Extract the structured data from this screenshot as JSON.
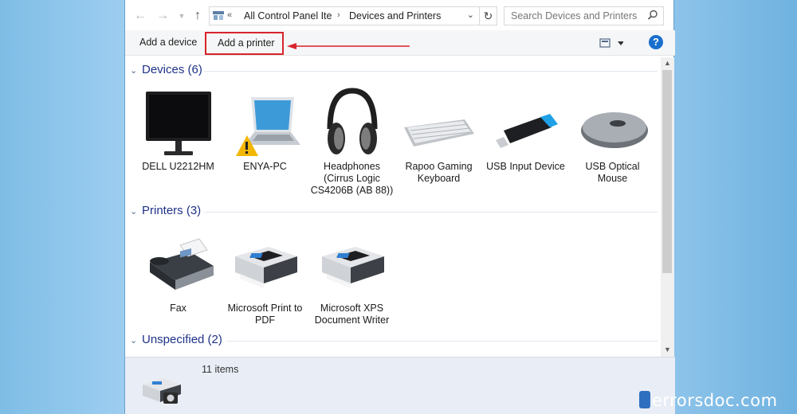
{
  "address_bar": {
    "back_icon": "arrow-left-icon",
    "forward_icon": "arrow-right-icon",
    "history_icon": "chevron-down-icon",
    "up_icon": "arrow-up-icon",
    "overflow": "«",
    "crumbs": [
      "All Control Panel Ite",
      "Devices and Printers"
    ],
    "search_placeholder": "Search Devices and Printers"
  },
  "toolbar": {
    "add_device": "Add a device",
    "add_printer": "Add a printer",
    "help": "?"
  },
  "groups": {
    "devices": {
      "title": "Devices (6)",
      "items": [
        {
          "label": "DELL U2212HM",
          "icon": "monitor-icon"
        },
        {
          "label": "ENYA-PC",
          "icon": "laptop-icon"
        },
        {
          "label": "Headphones (Cirrus Logic CS4206B (AB 88))",
          "icon": "headphones-icon"
        },
        {
          "label": "Rapoo Gaming Keyboard",
          "icon": "keyboard-icon"
        },
        {
          "label": "USB Input Device",
          "icon": "usb-dongle-icon"
        },
        {
          "label": "USB Optical Mouse",
          "icon": "mouse-icon"
        }
      ]
    },
    "printers": {
      "title": "Printers (3)",
      "items": [
        {
          "label": "Fax",
          "icon": "fax-icon"
        },
        {
          "label": "Microsoft Print to PDF",
          "icon": "printer-icon"
        },
        {
          "label": "Microsoft XPS Document Writer",
          "icon": "printer-icon"
        }
      ]
    },
    "unspecified": {
      "title": "Unspecified (2)"
    }
  },
  "status": {
    "item_count": "11 items"
  },
  "watermark": "errorsdoc.com",
  "colors": {
    "highlight": "#d8242c",
    "group_title": "#1e3287",
    "help_button": "#1a6fce"
  }
}
